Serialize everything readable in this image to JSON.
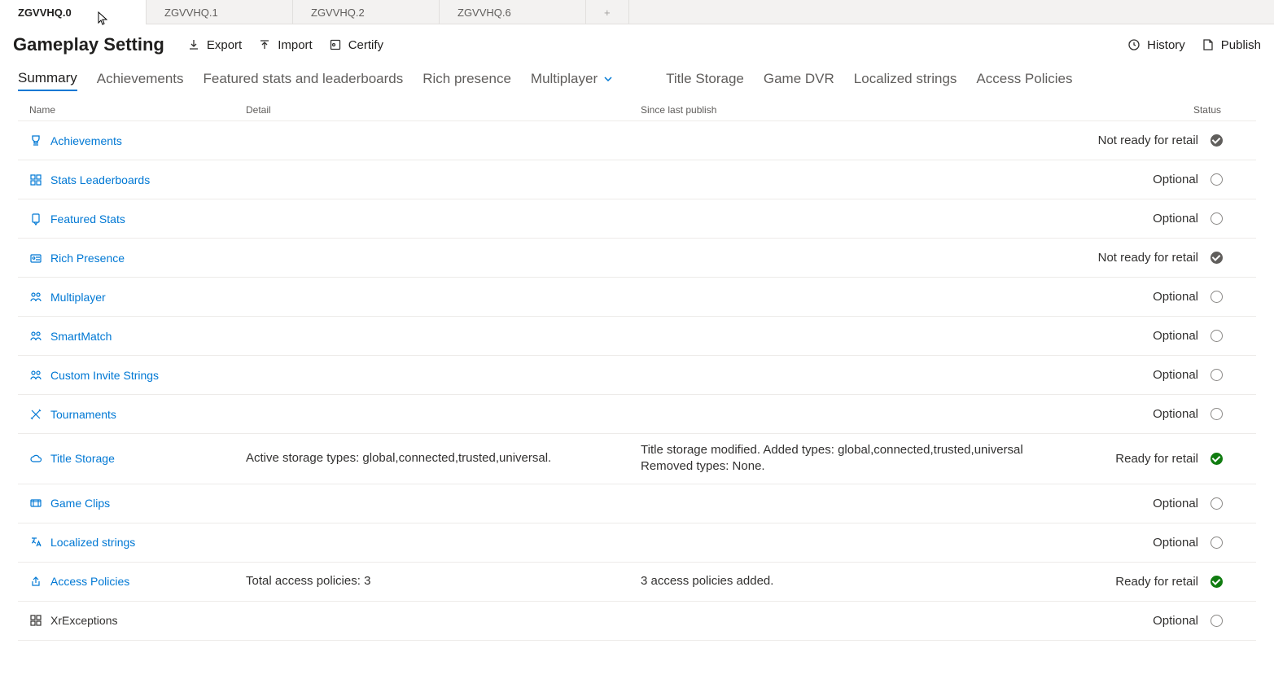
{
  "tabs": [
    {
      "label": "ZGVVHQ.0",
      "active": true
    },
    {
      "label": "ZGVVHQ.1",
      "active": false
    },
    {
      "label": "ZGVVHQ.2",
      "active": false
    },
    {
      "label": "ZGVVHQ.6",
      "active": false
    }
  ],
  "page_title": "Gameplay Setting",
  "actions": {
    "export": "Export",
    "import": "Import",
    "certify": "Certify",
    "history": "History",
    "publish": "Publish"
  },
  "pivots": [
    "Summary",
    "Achievements",
    "Featured stats and leaderboards",
    "Rich presence",
    "Multiplayer",
    "Title Storage",
    "Game DVR",
    "Localized strings",
    "Access Policies"
  ],
  "columns": {
    "name": "Name",
    "detail": "Detail",
    "since": "Since last publish",
    "status": "Status"
  },
  "rows": [
    {
      "icon": "trophy",
      "name": "Achievements",
      "detail": "",
      "since": "",
      "status": "Not ready for retail",
      "dot": "gray",
      "link": true
    },
    {
      "icon": "grid",
      "name": "Stats Leaderboards",
      "detail": "",
      "since": "",
      "status": "Optional",
      "dot": "empty",
      "link": true
    },
    {
      "icon": "badge",
      "name": "Featured Stats",
      "detail": "",
      "since": "",
      "status": "Optional",
      "dot": "empty",
      "link": true
    },
    {
      "icon": "card",
      "name": "Rich Presence",
      "detail": "",
      "since": "",
      "status": "Not ready for retail",
      "dot": "gray",
      "link": true
    },
    {
      "icon": "people",
      "name": "Multiplayer",
      "detail": "",
      "since": "",
      "status": "Optional",
      "dot": "empty",
      "link": true
    },
    {
      "icon": "people",
      "name": "SmartMatch",
      "detail": "",
      "since": "",
      "status": "Optional",
      "dot": "empty",
      "link": true
    },
    {
      "icon": "people",
      "name": "Custom Invite Strings",
      "detail": "",
      "since": "",
      "status": "Optional",
      "dot": "empty",
      "link": true
    },
    {
      "icon": "cross-swords",
      "name": "Tournaments",
      "detail": "",
      "since": "",
      "status": "Optional",
      "dot": "empty",
      "link": true
    },
    {
      "icon": "cloud",
      "name": "Title Storage",
      "detail": "Active storage types: global,connected,trusted,universal.",
      "since": "Title storage modified. Added types: global,connected,trusted,universal\nRemoved types: None.",
      "status": "Ready for retail",
      "dot": "green",
      "link": true
    },
    {
      "icon": "clip",
      "name": "Game Clips",
      "detail": "",
      "since": "",
      "status": "Optional",
      "dot": "empty",
      "link": true
    },
    {
      "icon": "translate",
      "name": "Localized strings",
      "detail": "",
      "since": "",
      "status": "Optional",
      "dot": "empty",
      "link": true
    },
    {
      "icon": "share",
      "name": "Access Policies",
      "detail": "Total access policies: 3",
      "since": "3 access policies added.",
      "status": "Ready for retail",
      "dot": "green",
      "link": true
    },
    {
      "icon": "grid",
      "name": "XrExceptions",
      "detail": "",
      "since": "",
      "status": "Optional",
      "dot": "empty",
      "link": false
    }
  ]
}
